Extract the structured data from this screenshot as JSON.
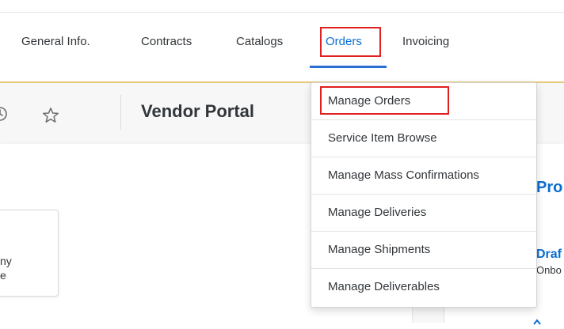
{
  "nav": {
    "tabs": [
      {
        "label": "General Info."
      },
      {
        "label": "Contracts"
      },
      {
        "label": "Catalogs"
      },
      {
        "label": "Orders"
      },
      {
        "label": "Invoicing"
      }
    ],
    "active_tab": "Orders"
  },
  "shell": {
    "title": "Vendor Portal"
  },
  "dropdown": {
    "items": [
      {
        "label": "Manage Orders"
      },
      {
        "label": "Service Item Browse"
      },
      {
        "label": "Manage Mass Confirmations"
      },
      {
        "label": "Manage Deliveries"
      },
      {
        "label": "Manage Shipments"
      },
      {
        "label": "Manage Deliverables"
      }
    ]
  },
  "content": {
    "tile_line1": "ny",
    "tile_line2": "e",
    "card_heading": "Pro",
    "card_status": "Draf",
    "card_sub": "Onbo"
  },
  "icons": {
    "history": "history-icon",
    "favorite": "star-icon"
  },
  "colors": {
    "accent": "#0a6ed1",
    "highlight_box": "#e02020",
    "nav_divider": "#e8c97a"
  }
}
